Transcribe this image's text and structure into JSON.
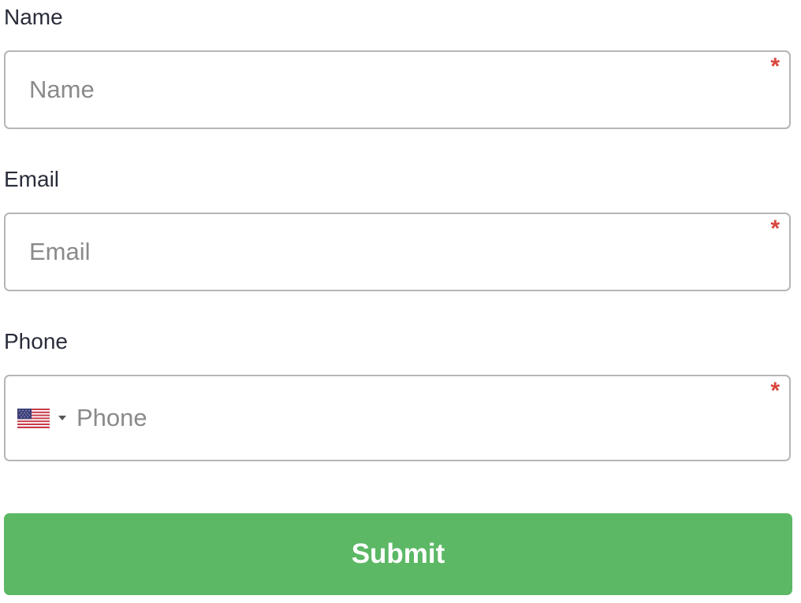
{
  "form": {
    "name": {
      "label": "Name",
      "placeholder": "Name",
      "value": "",
      "required_marker": "*"
    },
    "email": {
      "label": "Email",
      "placeholder": "Email",
      "value": "",
      "required_marker": "*"
    },
    "phone": {
      "label": "Phone",
      "placeholder": "Phone",
      "value": "",
      "required_marker": "*",
      "country_flag_icon": "us-flag-icon"
    },
    "submit_label": "Submit"
  },
  "colors": {
    "submit_bg": "#5cb865",
    "required": "#d9453d",
    "label_text": "#2a2d3a",
    "border": "#b6b6b6",
    "placeholder": "#8a8a8a"
  }
}
